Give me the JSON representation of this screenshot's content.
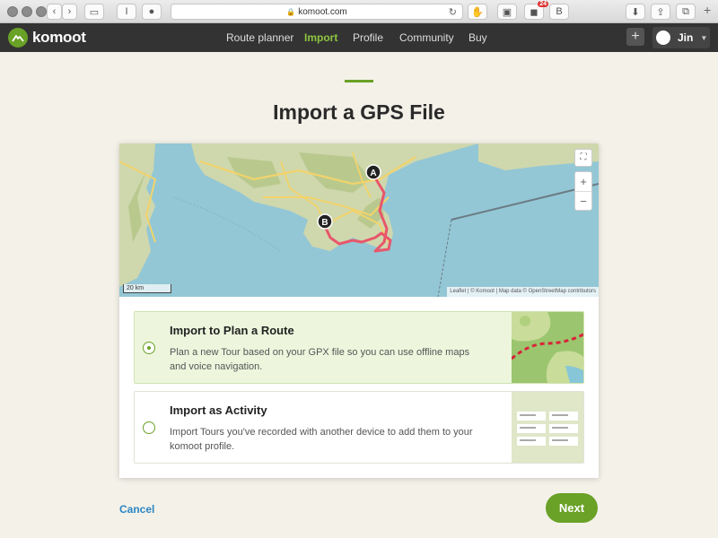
{
  "browser": {
    "url": "komoot.com",
    "notification_count": "24",
    "extension_letter": "B"
  },
  "nav": {
    "brand": "komoot",
    "links": [
      "Route planner",
      "Import",
      "Profile",
      "Community",
      "Buy"
    ],
    "active_link": "Import",
    "user_name": "Jin"
  },
  "page": {
    "title": "Import a GPS File"
  },
  "map": {
    "marker_start": "A",
    "marker_end": "B",
    "scale_label": "20 km",
    "attribution": "Leaflet | © Komoot | Map data © OpenStreetMap contributors",
    "zoom_in": "+",
    "zoom_out": "−"
  },
  "options": [
    {
      "title": "Import to Plan a Route",
      "description": "Plan a new Tour based on your GPX file so you can use offline maps and voice navigation.",
      "selected": true
    },
    {
      "title": "Import as Activity",
      "description": "Import Tours you've recorded with another device to add them to your komoot profile.",
      "selected": false
    }
  ],
  "actions": {
    "cancel_label": "Cancel",
    "next_label": "Next"
  },
  "colors": {
    "brand_green": "#6aa127",
    "nav_bg": "#333333",
    "route_red": "#e8566b",
    "link_blue": "#2d86c4",
    "page_bg": "#f3f1e8"
  }
}
